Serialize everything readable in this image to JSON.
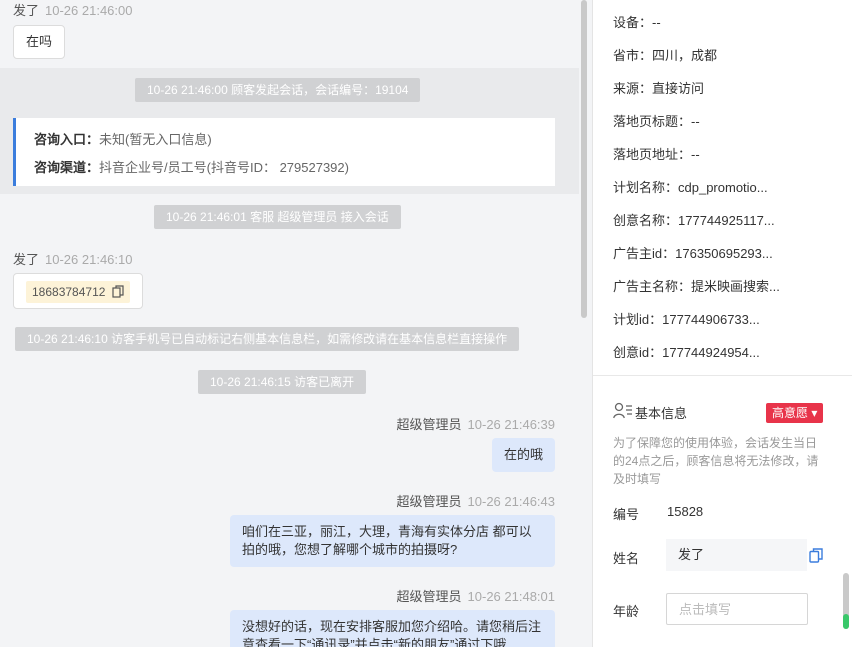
{
  "chat": {
    "msg1": {
      "sender": "发了",
      "time": "10-26 21:46:00",
      "text": "在吗"
    },
    "sys1": "10-26 21:46:00 顾客发起会话，会话编号：19104",
    "consult": {
      "entry_label": "咨询入口：",
      "entry_value": "未知(暂无入口信息)",
      "channel_label": "咨询渠道：",
      "channel_value": "抖音企业号/员工号(抖音号ID： 279527392)"
    },
    "sys2": "10-26 21:46:01 客服 超级管理员 接入会话",
    "msg2": {
      "sender": "发了",
      "time": "10-26 21:46:10",
      "phone": "18683784712"
    },
    "sys3": "10-26 21:46:10 访客手机号已自动标记右侧基本信息栏，如需修改请在基本信息栏直接操作",
    "sys4": "10-26 21:46:15 访客已离开",
    "reply1": {
      "sender": "超级管理员",
      "time": "10-26 21:46:39",
      "text": "在的哦"
    },
    "reply2": {
      "sender": "超级管理员",
      "time": "10-26 21:46:43",
      "line1": "咱们在三亚，丽江，大理，青海有实体分店 都可以",
      "line2": "拍的哦，您想了解哪个城市的拍摄呀?"
    },
    "reply3": {
      "sender": "超级管理员",
      "time": "10-26 21:48:01",
      "line1": "没想好的话，现在安排客服加您介绍哈。请您稍后注",
      "line2": "意查看一下“通讯录”并点击“新的朋友”通过下哦"
    }
  },
  "panel": {
    "info": [
      {
        "label": "设备：",
        "value": "--"
      },
      {
        "label": "省市：",
        "value": "四川，成都"
      },
      {
        "label": "来源：",
        "value": "直接访问"
      },
      {
        "label": "落地页标题：",
        "value": "--"
      },
      {
        "label": "落地页地址：",
        "value": "--"
      },
      {
        "label": "计划名称：",
        "value": "cdp_promotio..."
      },
      {
        "label": "创意名称：",
        "value": "177744925117..."
      },
      {
        "label": "广告主id：",
        "value": "176350695293..."
      },
      {
        "label": "广告主名称：",
        "value": "提米映画搜索..."
      },
      {
        "label": "计划id：",
        "value": "177744906733..."
      },
      {
        "label": "创意id：",
        "value": "177744924954..."
      }
    ],
    "basic_title": "基本信息",
    "intent_badge": "高意愿 ▾",
    "note": "为了保障您的使用体验，会话发生当日的24点之后，顾客信息将无法修改，请及时填写",
    "id_label": "编号",
    "id_value": "15828",
    "name_label": "姓名",
    "name_value": "发了",
    "age_label": "年龄",
    "age_placeholder": "点击填写"
  },
  "colors": {
    "accent": "#3b7ddd",
    "badge": "#e8344a",
    "bubble_out": "#dde8fb"
  }
}
